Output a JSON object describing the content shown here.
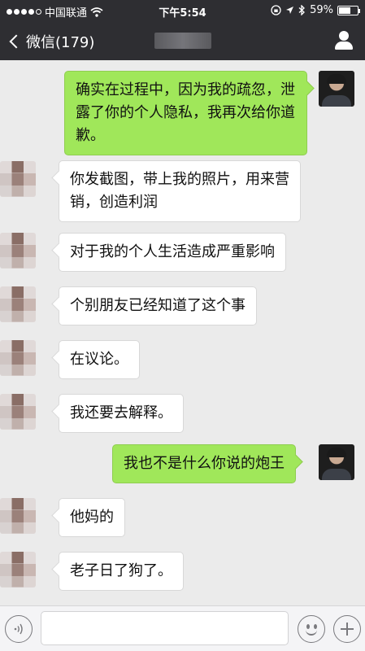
{
  "status_bar": {
    "carrier": "中国联通",
    "time": "下午5:54",
    "battery": "59%",
    "battery_level": 0.59,
    "icons": [
      "signal-dots-icon",
      "wifi-icon",
      "rotation-lock-icon",
      "location-arrow-icon",
      "bluetooth-icon",
      "battery-icon"
    ]
  },
  "nav": {
    "back_label": "微信(179)",
    "title": "",
    "icons": [
      "back-chevron-icon",
      "contact-profile-icon"
    ]
  },
  "messages": [
    {
      "from": "me",
      "text": "确实在过程中，因为我的疏忽，泄露了你的个人隐私，我再次给你道歉。"
    },
    {
      "from": "other",
      "text": "你发截图，带上我的照片，用来营销，创造利润"
    },
    {
      "from": "other",
      "text": "对于我的个人生活造成严重影响"
    },
    {
      "from": "other",
      "text": "个别朋友已经知道了这个事"
    },
    {
      "from": "other",
      "text": "在议论。"
    },
    {
      "from": "other",
      "text": "我还要去解释。"
    },
    {
      "from": "me",
      "text": "我也不是什么你说的炮王"
    },
    {
      "from": "other",
      "text": "他妈的"
    },
    {
      "from": "other",
      "text": "老子日了狗了。"
    }
  ],
  "input_bar": {
    "placeholder": "",
    "icons": [
      "voice-icon",
      "emoji-icon",
      "plus-icon"
    ]
  },
  "colors": {
    "nav_background": "#2e2e32",
    "chat_background": "#ebebeb",
    "outgoing_bubble": "#a0e75a",
    "incoming_bubble": "#ffffff"
  }
}
